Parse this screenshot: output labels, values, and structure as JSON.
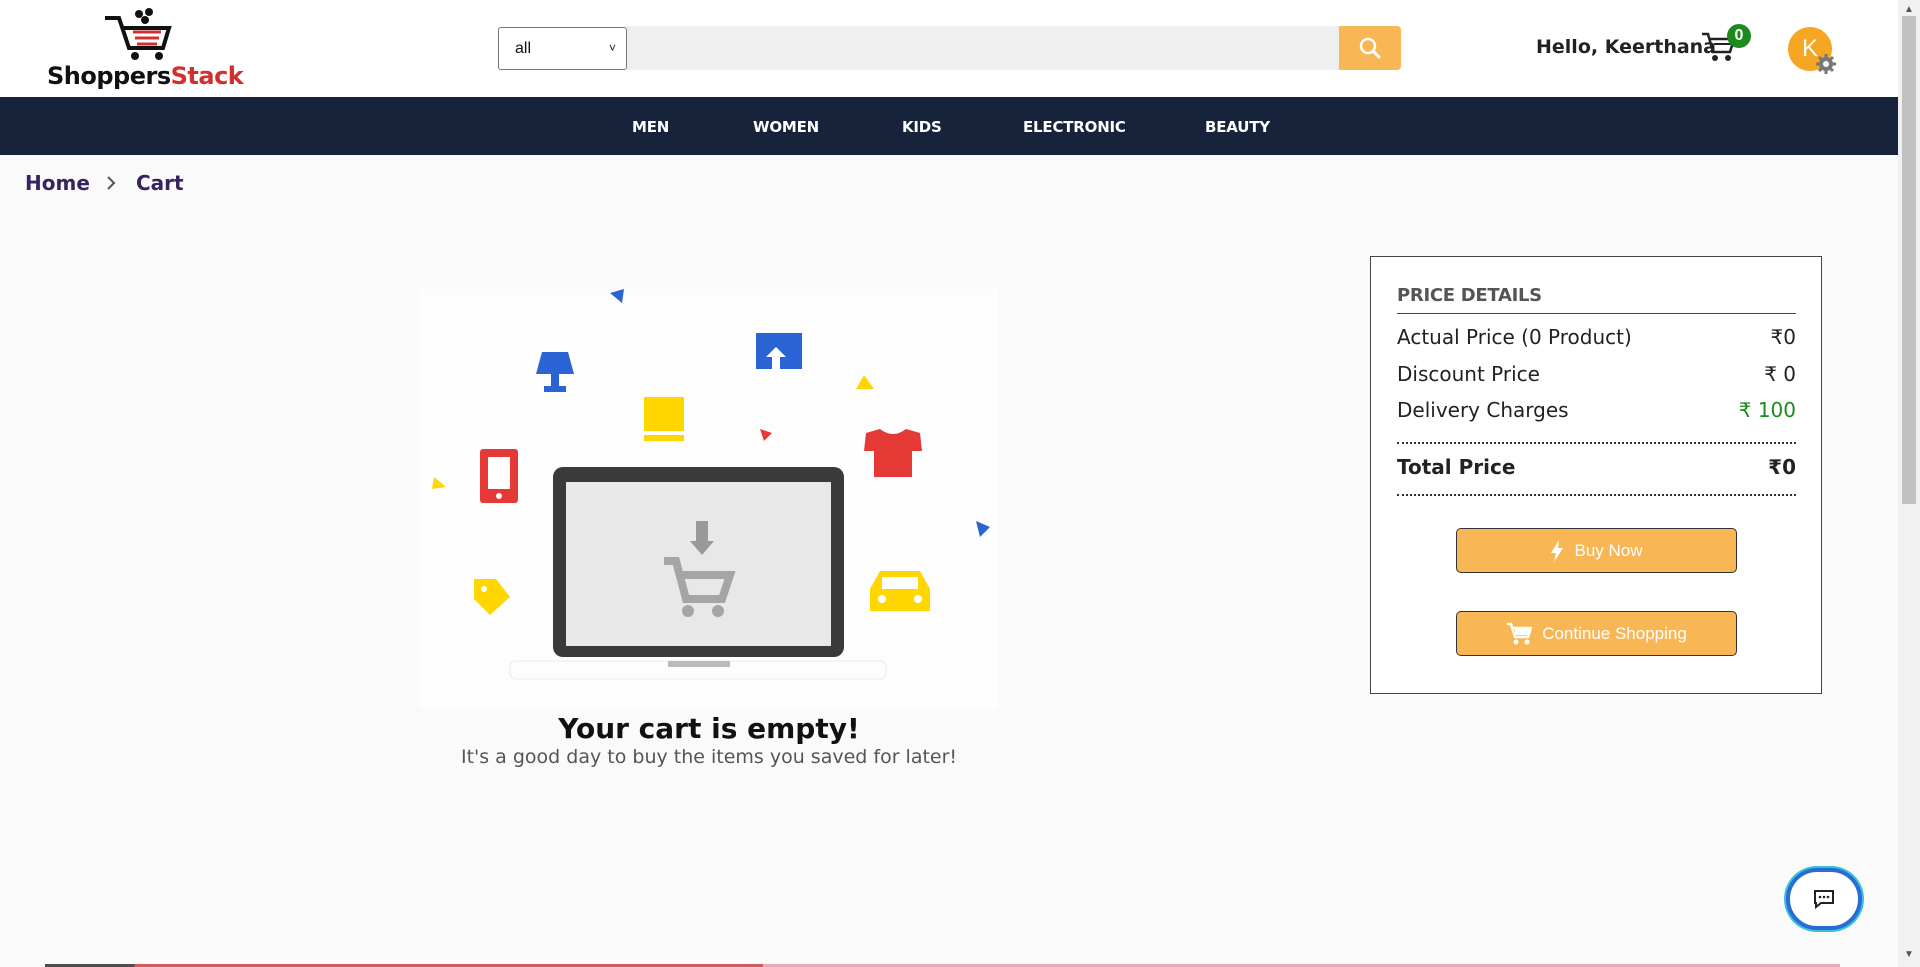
{
  "logo": {
    "text_part1": "Shoppers",
    "text_part2": "Stack"
  },
  "search": {
    "category": "all",
    "placeholder": ""
  },
  "header": {
    "greeting": "Hello, Keerthana",
    "cart_count": "0",
    "avatar_initial": "K"
  },
  "nav": {
    "items": [
      "MEN",
      "WOMEN",
      "KIDS",
      "ELECTRONIC",
      "BEAUTY"
    ]
  },
  "breadcrumb": {
    "home": "Home",
    "current": "Cart"
  },
  "empty_cart": {
    "title": "Your cart is empty!",
    "subtitle": "It's a good day to buy the items you saved for later!"
  },
  "price_details": {
    "title": "PRICE DETAILS",
    "actual_label": "Actual Price (0 Product)",
    "actual_value": "₹0",
    "discount_label": "Discount Price",
    "discount_value": "₹ 0",
    "delivery_label": "Delivery Charges",
    "delivery_value": "₹ 100",
    "total_label": "Total Price",
    "total_value": "₹0",
    "buy_now": "Buy Now",
    "continue_shopping": "Continue Shopping"
  },
  "colors": {
    "accent": "#f9b654",
    "nav_bg": "#16233a",
    "brand_red": "#d32f2f",
    "green": "#1e8a1e"
  },
  "icons": [
    "cart-logo-icon",
    "search-icon",
    "cart-icon",
    "gear-icon",
    "chevron-right-icon",
    "lightning-icon",
    "cart-icon",
    "chat-icon"
  ]
}
